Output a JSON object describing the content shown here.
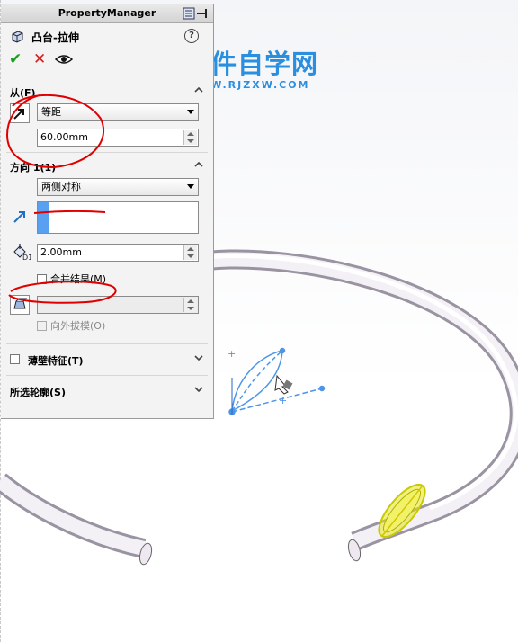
{
  "watermark": {
    "title": "软件自学网",
    "url": "WWW.RJZXW.COM"
  },
  "property_manager": {
    "title": "PropertyManager",
    "feature_name": "凸台-拉伸",
    "help_symbol": "?",
    "actions": {
      "ok_symbol": "✔",
      "cancel_symbol": "✕"
    },
    "from": {
      "label": "从(F)",
      "selected": "等距",
      "offset_value": "60.00mm"
    },
    "direction1": {
      "label": "方向 1(1)",
      "end_condition": "两侧对称",
      "depth_value": "2.00mm",
      "merge_label": "合并结果(M)",
      "merge_checked": false,
      "draft_value": "",
      "draft_outward_label": "向外拔模(O)",
      "draft_outward_checked": false
    },
    "thin_feature": {
      "label": "薄壁特征(T)",
      "checked": false
    },
    "selected_contours": {
      "label": "所选轮廓(S)"
    }
  },
  "annotations": {
    "color": "#e00000"
  },
  "colors": {
    "accent_blue": "#5aa0f0",
    "preview_yellow": "#e6e61a",
    "watermark": "#2b8fe0"
  }
}
